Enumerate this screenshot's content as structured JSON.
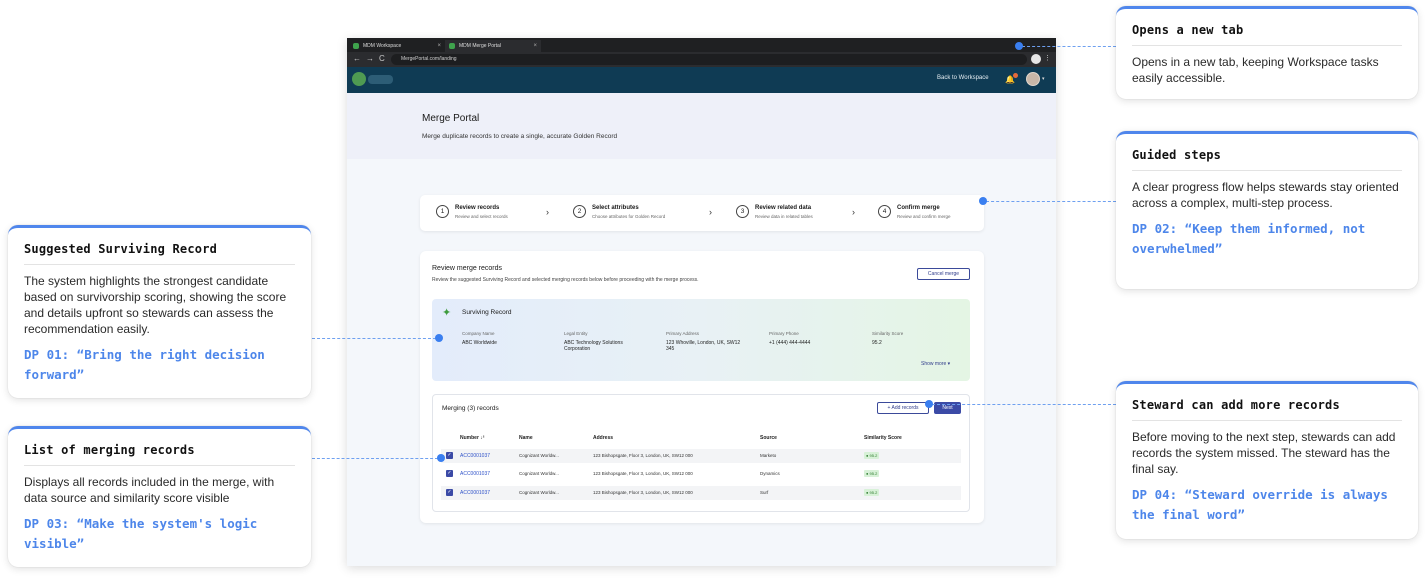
{
  "browser": {
    "tabs": [
      {
        "label": "MDM Workspace",
        "close": "×"
      },
      {
        "label": "MDM Merge Portal",
        "close": "×"
      }
    ],
    "nav": {
      "back": "←",
      "forward": "→",
      "reload": "C"
    },
    "url": "MergePortal.com/landing",
    "kebab": "⋮"
  },
  "appbar": {
    "back_label": "Back to Workspace",
    "bell": "🔔",
    "caret": "▾"
  },
  "page": {
    "title": "Merge Portal",
    "subtitle": "Merge duplicate records to create a single, accurate Golden Record"
  },
  "steps": [
    {
      "num": "1",
      "title": "Review records",
      "sub": "Review and select records"
    },
    {
      "num": "2",
      "title": "Select attributes",
      "sub": "Choose attributes for Golden Record"
    },
    {
      "num": "3",
      "title": "Review related data",
      "sub": "Review data in related tables"
    },
    {
      "num": "4",
      "title": "Confirm merge",
      "sub": "Review and confirm merge"
    }
  ],
  "step_chevron": "›",
  "review": {
    "title": "Review merge records",
    "subtitle": "Review the suggested Surviving Record and selected merging records below before proceeding with the merge process.",
    "cancel_label": "Cancel merge"
  },
  "survivor": {
    "icon": "✦",
    "title": "Surviving Record",
    "fields": [
      {
        "label": "Company Name",
        "value": "ABC Worldwide"
      },
      {
        "label": "Legal Entity",
        "value": "ABC Technology Solutions Corporation"
      },
      {
        "label": "Primary Address",
        "value": "123 Whoville, London, UK, SW12 345"
      },
      {
        "label": "Primary Phone",
        "value": "+1 (444) 444-4444"
      },
      {
        "label": "Similarity Score",
        "value": "95.2"
      }
    ],
    "show_more": "Show more ▾"
  },
  "merging": {
    "title": "Merging (3) records",
    "add_label": "+ Add records",
    "next_label": "Next",
    "headers": [
      "Number ↓²",
      "Name",
      "Address",
      "Source",
      "Similarity Score"
    ],
    "rows": [
      {
        "number": "ACC0001037",
        "name": "Cognizant Worldw...",
        "address": "123 Bishopsgate, Floor 3, London, UK, SW12 000",
        "source": "Marketo",
        "score": "● 95.2"
      },
      {
        "number": "ACC0001037",
        "name": "Cognizant Worldw...",
        "address": "123 Bishopsgate, Floor 3, London, UK, SW12 000",
        "source": "Dynamics",
        "score": "● 95.2"
      },
      {
        "number": "ACC0001037",
        "name": "Cognizant Worldw...",
        "address": "123 Bishopsgate, Floor 3, London, UK, SW12 000",
        "source": "Surf",
        "score": "● 95.2"
      }
    ],
    "check": "✓"
  },
  "annotations": {
    "new_tab": {
      "title": "Opens a new tab",
      "body": "Opens in a new tab, keeping Workspace tasks easily accessible."
    },
    "guided": {
      "title": "Guided steps",
      "body": "A clear progress flow helps stewards stay oriented across a complex, multi-step process.",
      "dp": "DP 02: “Keep them informed, not overwhelmed”"
    },
    "suggested": {
      "title": "Suggested Surviving Record",
      "body": "The system highlights the strongest candidate based on survivorship scoring, showing the score and details upfront so stewards can assess the recommendation easily.",
      "dp": "DP 01: “Bring the right decision forward”"
    },
    "list": {
      "title": "List of merging records",
      "body": "Displays all records included in the merge, with data source and similarity score visible",
      "dp": "DP 03: “Make the system's logic visible”"
    },
    "steward": {
      "title": "Steward can add more records",
      "body": "Before moving to the next step, stewards can add records the system missed. The steward has the final say.",
      "dp": "DP 04: “Steward override is always the final word”"
    }
  },
  "colors": {
    "accent": "#4f86ec",
    "appbar": "#0f3b54",
    "primary_button": "#3b4aa6"
  }
}
